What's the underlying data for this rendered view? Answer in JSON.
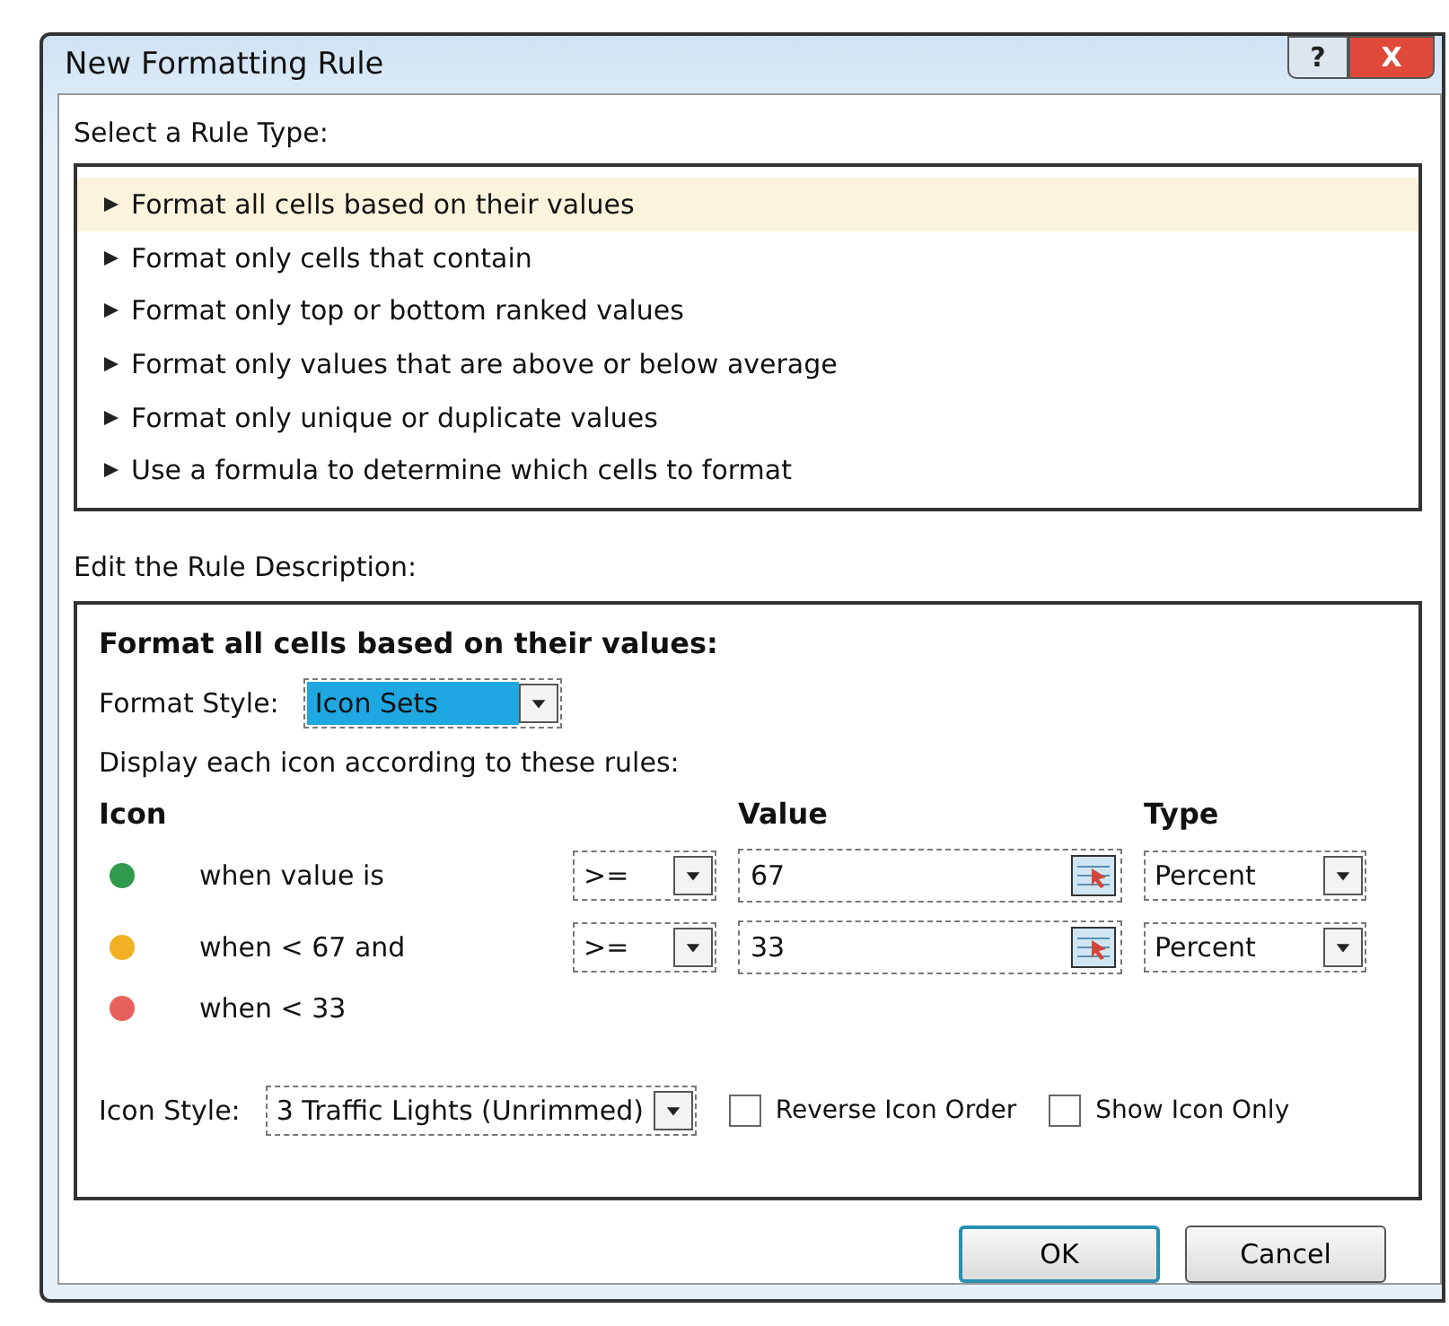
{
  "window": {
    "title": "New Formatting Rule",
    "help": "?",
    "close": "X"
  },
  "rule_type": {
    "label": "Select a Rule Type:",
    "items": [
      {
        "label": "Format all cells based on their values",
        "selected": true
      },
      {
        "label": "Format only cells that contain",
        "selected": false
      },
      {
        "label": "Format only top or bottom ranked values",
        "selected": false
      },
      {
        "label": "Format only values that are above or below average",
        "selected": false
      },
      {
        "label": "Format only unique or duplicate values",
        "selected": false
      },
      {
        "label": "Use a formula to determine which cells to format",
        "selected": false
      }
    ]
  },
  "description": {
    "label": "Edit the Rule Description:",
    "heading": "Format all cells based on their values:",
    "format_style": {
      "label": "Format Style:",
      "value": "Icon Sets",
      "focused": true
    },
    "instruction": "Display each icon according to these rules:",
    "columns": {
      "icon": "Icon",
      "value": "Value",
      "type": "Type"
    },
    "rules": [
      {
        "color": "#2f9a4c",
        "condition": "when value is",
        "operator": ">=",
        "value": "67",
        "type": "Percent"
      },
      {
        "color": "#f2b124",
        "condition": "when < 67 and",
        "operator": ">=",
        "value": "33",
        "type": "Percent"
      },
      {
        "color": "#e8605c",
        "condition": "when < 33"
      }
    ],
    "icon_style": {
      "label": "Icon Style:",
      "value": "3 Traffic Lights (Unrimmed)"
    },
    "checkboxes": [
      {
        "label": "Reverse Icon Order",
        "checked": false
      },
      {
        "label": "Show Icon Only",
        "checked": false
      }
    ]
  },
  "buttons": [
    {
      "label": "OK",
      "default": true
    },
    {
      "label": "Cancel",
      "default": false
    }
  ]
}
